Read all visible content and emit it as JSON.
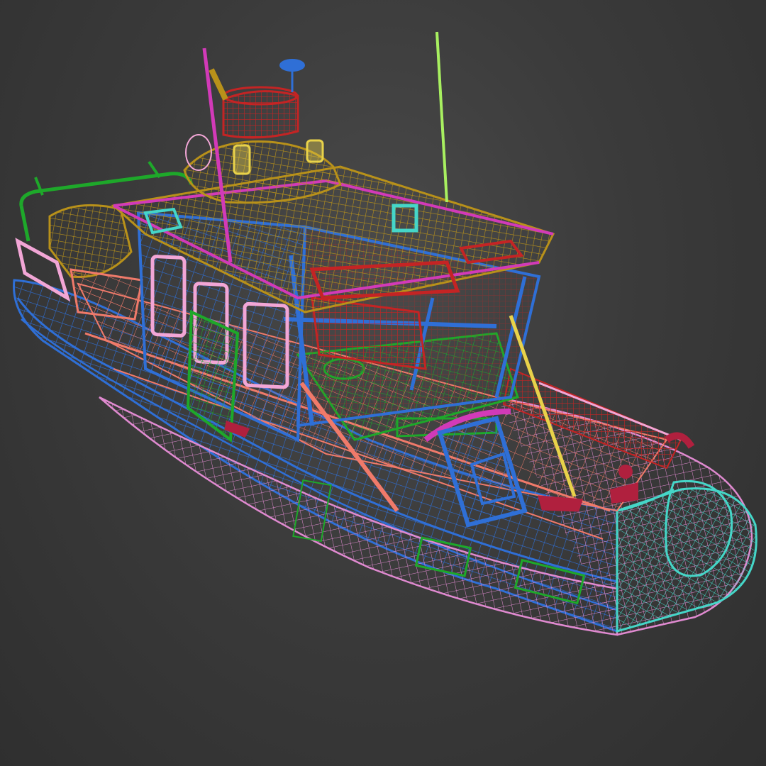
{
  "scene": {
    "background": "#3c3c3c",
    "subject": "boat-wireframe",
    "palette": {
      "hull_blue": "#2f6fd6",
      "hull_pink": "#e08ad0",
      "hull_cyan": "#45d6c8",
      "deck_green": "#1ea82a",
      "cabin_gold": "#b8911a",
      "magenta": "#d23ab8",
      "salmon": "#f07a6a",
      "red": "#c42424",
      "crimson": "#b0203e",
      "yellow": "#e8d24a",
      "lime": "#a8f060",
      "light_pink": "#f2a6d6"
    }
  }
}
